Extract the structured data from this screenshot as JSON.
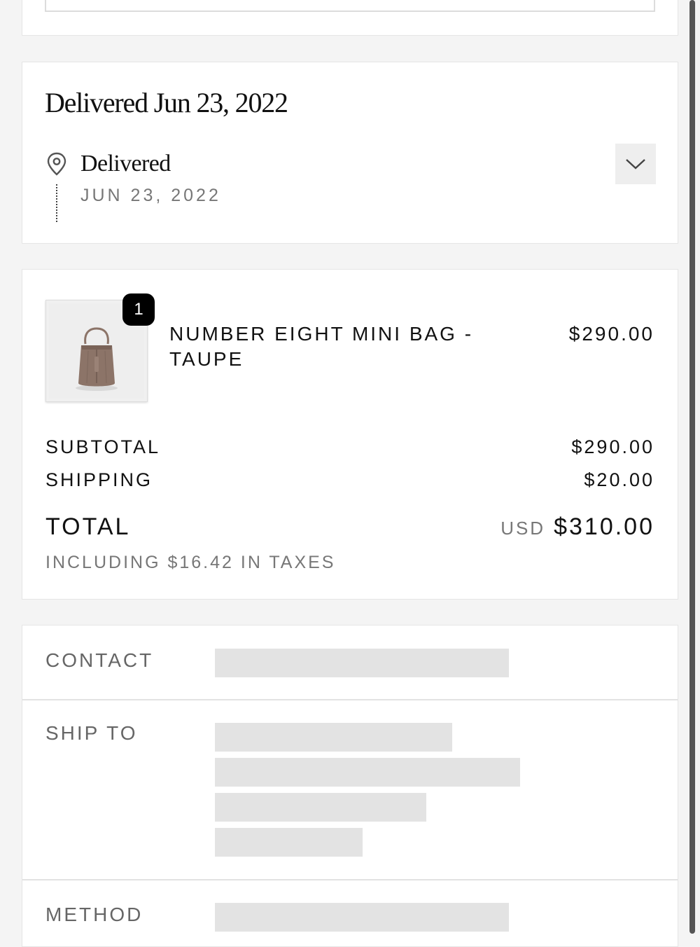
{
  "shipment": {
    "title": "Delivered Jun 23, 2022",
    "status": "Delivered",
    "status_date": "JUN 23, 2022",
    "icon": "location-pin-icon",
    "expand_icon": "chevron-down-icon"
  },
  "order": {
    "item": {
      "name": "NUMBER EIGHT MINI BAG - TAUPE",
      "price": "$290.00",
      "quantity": "1",
      "color": "#8c7468"
    },
    "subtotal_label": "SUBTOTAL",
    "subtotal_value": "$290.00",
    "shipping_label": "SHIPPING",
    "shipping_value": "$20.00",
    "total_label": "TOTAL",
    "currency": "USD",
    "total_value": "$310.00",
    "tax_note": "INCLUDING $16.42 IN TAXES"
  },
  "customer": {
    "contact_label": "CONTACT",
    "ship_to_label": "SHIP TO",
    "method_label": "METHOD"
  }
}
